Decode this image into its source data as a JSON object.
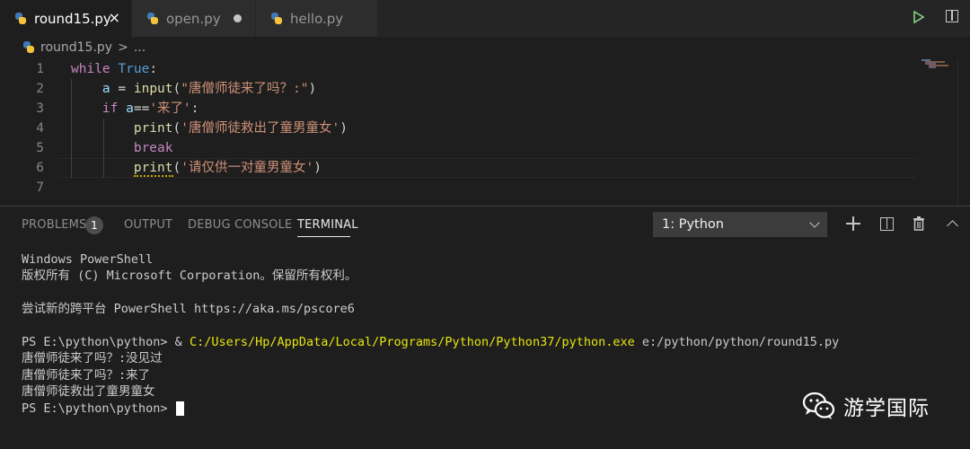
{
  "tabs": [
    {
      "label": "round15.py",
      "active": true,
      "close": "×"
    },
    {
      "label": "open.py",
      "active": false,
      "modified": true
    },
    {
      "label": "hello.py",
      "active": false
    }
  ],
  "breadcrumb": {
    "file": "round15.py",
    "separator": ">",
    "rest": "..."
  },
  "editor": {
    "line_numbers": [
      "1",
      "2",
      "3",
      "4",
      "5",
      "6",
      "7"
    ],
    "lines": [
      [
        {
          "t": "while",
          "c": "kw"
        },
        {
          "t": " "
        },
        {
          "t": "True",
          "c": "bi"
        },
        {
          "t": ":"
        }
      ],
      [
        {
          "t": "    "
        },
        {
          "t": "a",
          "c": "var"
        },
        {
          "t": " = "
        },
        {
          "t": "input",
          "c": "fn"
        },
        {
          "t": "("
        },
        {
          "t": "\"唐僧师徒来了吗？:\"",
          "c": "str"
        },
        {
          "t": ")"
        }
      ],
      [
        {
          "t": "    "
        },
        {
          "t": "if",
          "c": "kw"
        },
        {
          "t": " "
        },
        {
          "t": "a",
          "c": "var"
        },
        {
          "t": "=="
        },
        {
          "t": "'来了'",
          "c": "str"
        },
        {
          "t": ":"
        }
      ],
      [
        {
          "t": "        "
        },
        {
          "t": "print",
          "c": "fn"
        },
        {
          "t": "("
        },
        {
          "t": "'唐僧师徒救出了童男童女'",
          "c": "str"
        },
        {
          "t": ")"
        }
      ],
      [
        {
          "t": "        "
        },
        {
          "t": "break",
          "c": "kw"
        }
      ],
      [
        {
          "t": "        "
        },
        {
          "t": "print",
          "c": "fn",
          "sq": true
        },
        {
          "t": "("
        },
        {
          "t": "'请仅供一对童男童女'",
          "c": "str"
        },
        {
          "t": ")"
        }
      ],
      []
    ]
  },
  "panel": {
    "tabs": [
      "PROBLEMS",
      "OUTPUT",
      "DEBUG CONSOLE",
      "TERMINAL"
    ],
    "problems_count": "1",
    "terminal_select": "1: Python"
  },
  "terminal": {
    "lines": [
      [
        {
          "t": "Windows PowerShell"
        }
      ],
      [
        {
          "t": "版权所有 (C) Microsoft Corporation。保留所有权利。"
        }
      ],
      [
        {
          "t": ""
        }
      ],
      [
        {
          "t": "尝试新的跨平台 PowerShell https://aka.ms/pscore6"
        }
      ],
      [
        {
          "t": ""
        }
      ],
      [
        {
          "t": "PS E:\\python\\python> & "
        },
        {
          "t": "C:/Users/Hp/AppData/Local/Programs/Python/Python37/python.exe",
          "c": "yellow"
        },
        {
          "t": " e:/python/python/round15.py"
        }
      ],
      [
        {
          "t": "唐僧师徒来了吗？:没见过"
        }
      ],
      [
        {
          "t": "唐僧师徒来了吗？:来了"
        }
      ],
      [
        {
          "t": "唐僧师徒救出了童男童女"
        }
      ],
      [
        {
          "t": "PS E:\\python\\python>"
        }
      ]
    ]
  },
  "watermark": {
    "text": "游学国际",
    "icon": "wechat-icon"
  },
  "colors": {
    "keyword": "#c586c0",
    "builtin": "#569cd6",
    "function": "#dcdcaa",
    "string": "#ce9178",
    "variable": "#9cdcfe",
    "terminal_path": "#e5e510"
  }
}
